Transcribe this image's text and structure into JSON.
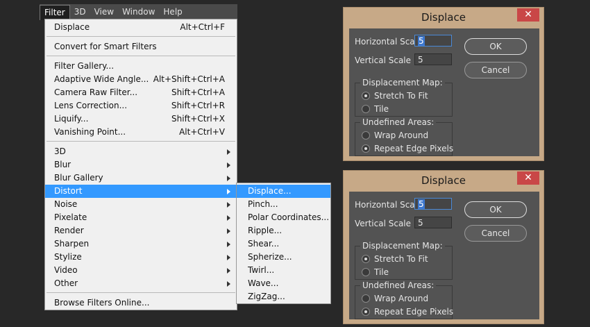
{
  "menubar": {
    "items": [
      "Filter",
      "3D",
      "View",
      "Window",
      "Help"
    ]
  },
  "filter_menu": {
    "group1": [
      {
        "label": "Displace",
        "shortcut": "Alt+Ctrl+F"
      }
    ],
    "group2": [
      {
        "label": "Convert for Smart Filters",
        "shortcut": ""
      }
    ],
    "group3": [
      {
        "label": "Filter Gallery...",
        "shortcut": ""
      },
      {
        "label": "Adaptive Wide Angle...",
        "shortcut": "Alt+Shift+Ctrl+A"
      },
      {
        "label": "Camera Raw Filter...",
        "shortcut": "Shift+Ctrl+A"
      },
      {
        "label": "Lens Correction...",
        "shortcut": "Shift+Ctrl+R"
      },
      {
        "label": "Liquify...",
        "shortcut": "Shift+Ctrl+X"
      },
      {
        "label": "Vanishing Point...",
        "shortcut": "Alt+Ctrl+V"
      }
    ],
    "group4": [
      {
        "label": "3D"
      },
      {
        "label": "Blur"
      },
      {
        "label": "Blur Gallery"
      },
      {
        "label": "Distort"
      },
      {
        "label": "Noise"
      },
      {
        "label": "Pixelate"
      },
      {
        "label": "Render"
      },
      {
        "label": "Sharpen"
      },
      {
        "label": "Stylize"
      },
      {
        "label": "Video"
      },
      {
        "label": "Other"
      }
    ],
    "highlighted": "Distort",
    "group5": [
      {
        "label": "Browse Filters Online...",
        "shortcut": ""
      }
    ]
  },
  "distort_submenu": {
    "items": [
      "Displace...",
      "Pinch...",
      "Polar Coordinates...",
      "Ripple...",
      "Shear...",
      "Spherize...",
      "Twirl...",
      "Wave...",
      "ZigZag..."
    ],
    "highlighted": "Displace..."
  },
  "dialogs": [
    {
      "title": "Displace",
      "close_glyph": "✕",
      "horizontal_scale_label": "Horizontal Scale",
      "horizontal_scale_value": "5",
      "vertical_scale_label": "Vertical Scale",
      "vertical_scale_value": "5",
      "ok_label": "OK",
      "cancel_label": "Cancel",
      "displacement_map_label": "Displacement Map:",
      "stretch_label": "Stretch To Fit",
      "tile_label": "Tile",
      "undefined_areas_label": "Undefined Areas:",
      "wrap_label": "Wrap Around",
      "repeat_label": "Repeat Edge Pixels",
      "map_selected": "stretch",
      "areas_selected": "repeat"
    },
    {
      "title": "Displace",
      "close_glyph": "✕",
      "horizontal_scale_label": "Horizontal Scale",
      "horizontal_scale_value": "5",
      "vertical_scale_label": "Vertical Scale",
      "vertical_scale_value": "5",
      "ok_label": "OK",
      "cancel_label": "Cancel",
      "displacement_map_label": "Displacement Map:",
      "stretch_label": "Stretch To Fit",
      "tile_label": "Tile",
      "undefined_areas_label": "Undefined Areas:",
      "wrap_label": "Wrap Around",
      "repeat_label": "Repeat Edge Pixels",
      "map_selected": "stretch",
      "areas_selected": "repeat"
    }
  ],
  "colors": {
    "highlight": "#3399ff",
    "dialog_frame": "#c7a987",
    "dialog_body": "#535353",
    "close_button": "#c94747",
    "background": "#282828"
  }
}
